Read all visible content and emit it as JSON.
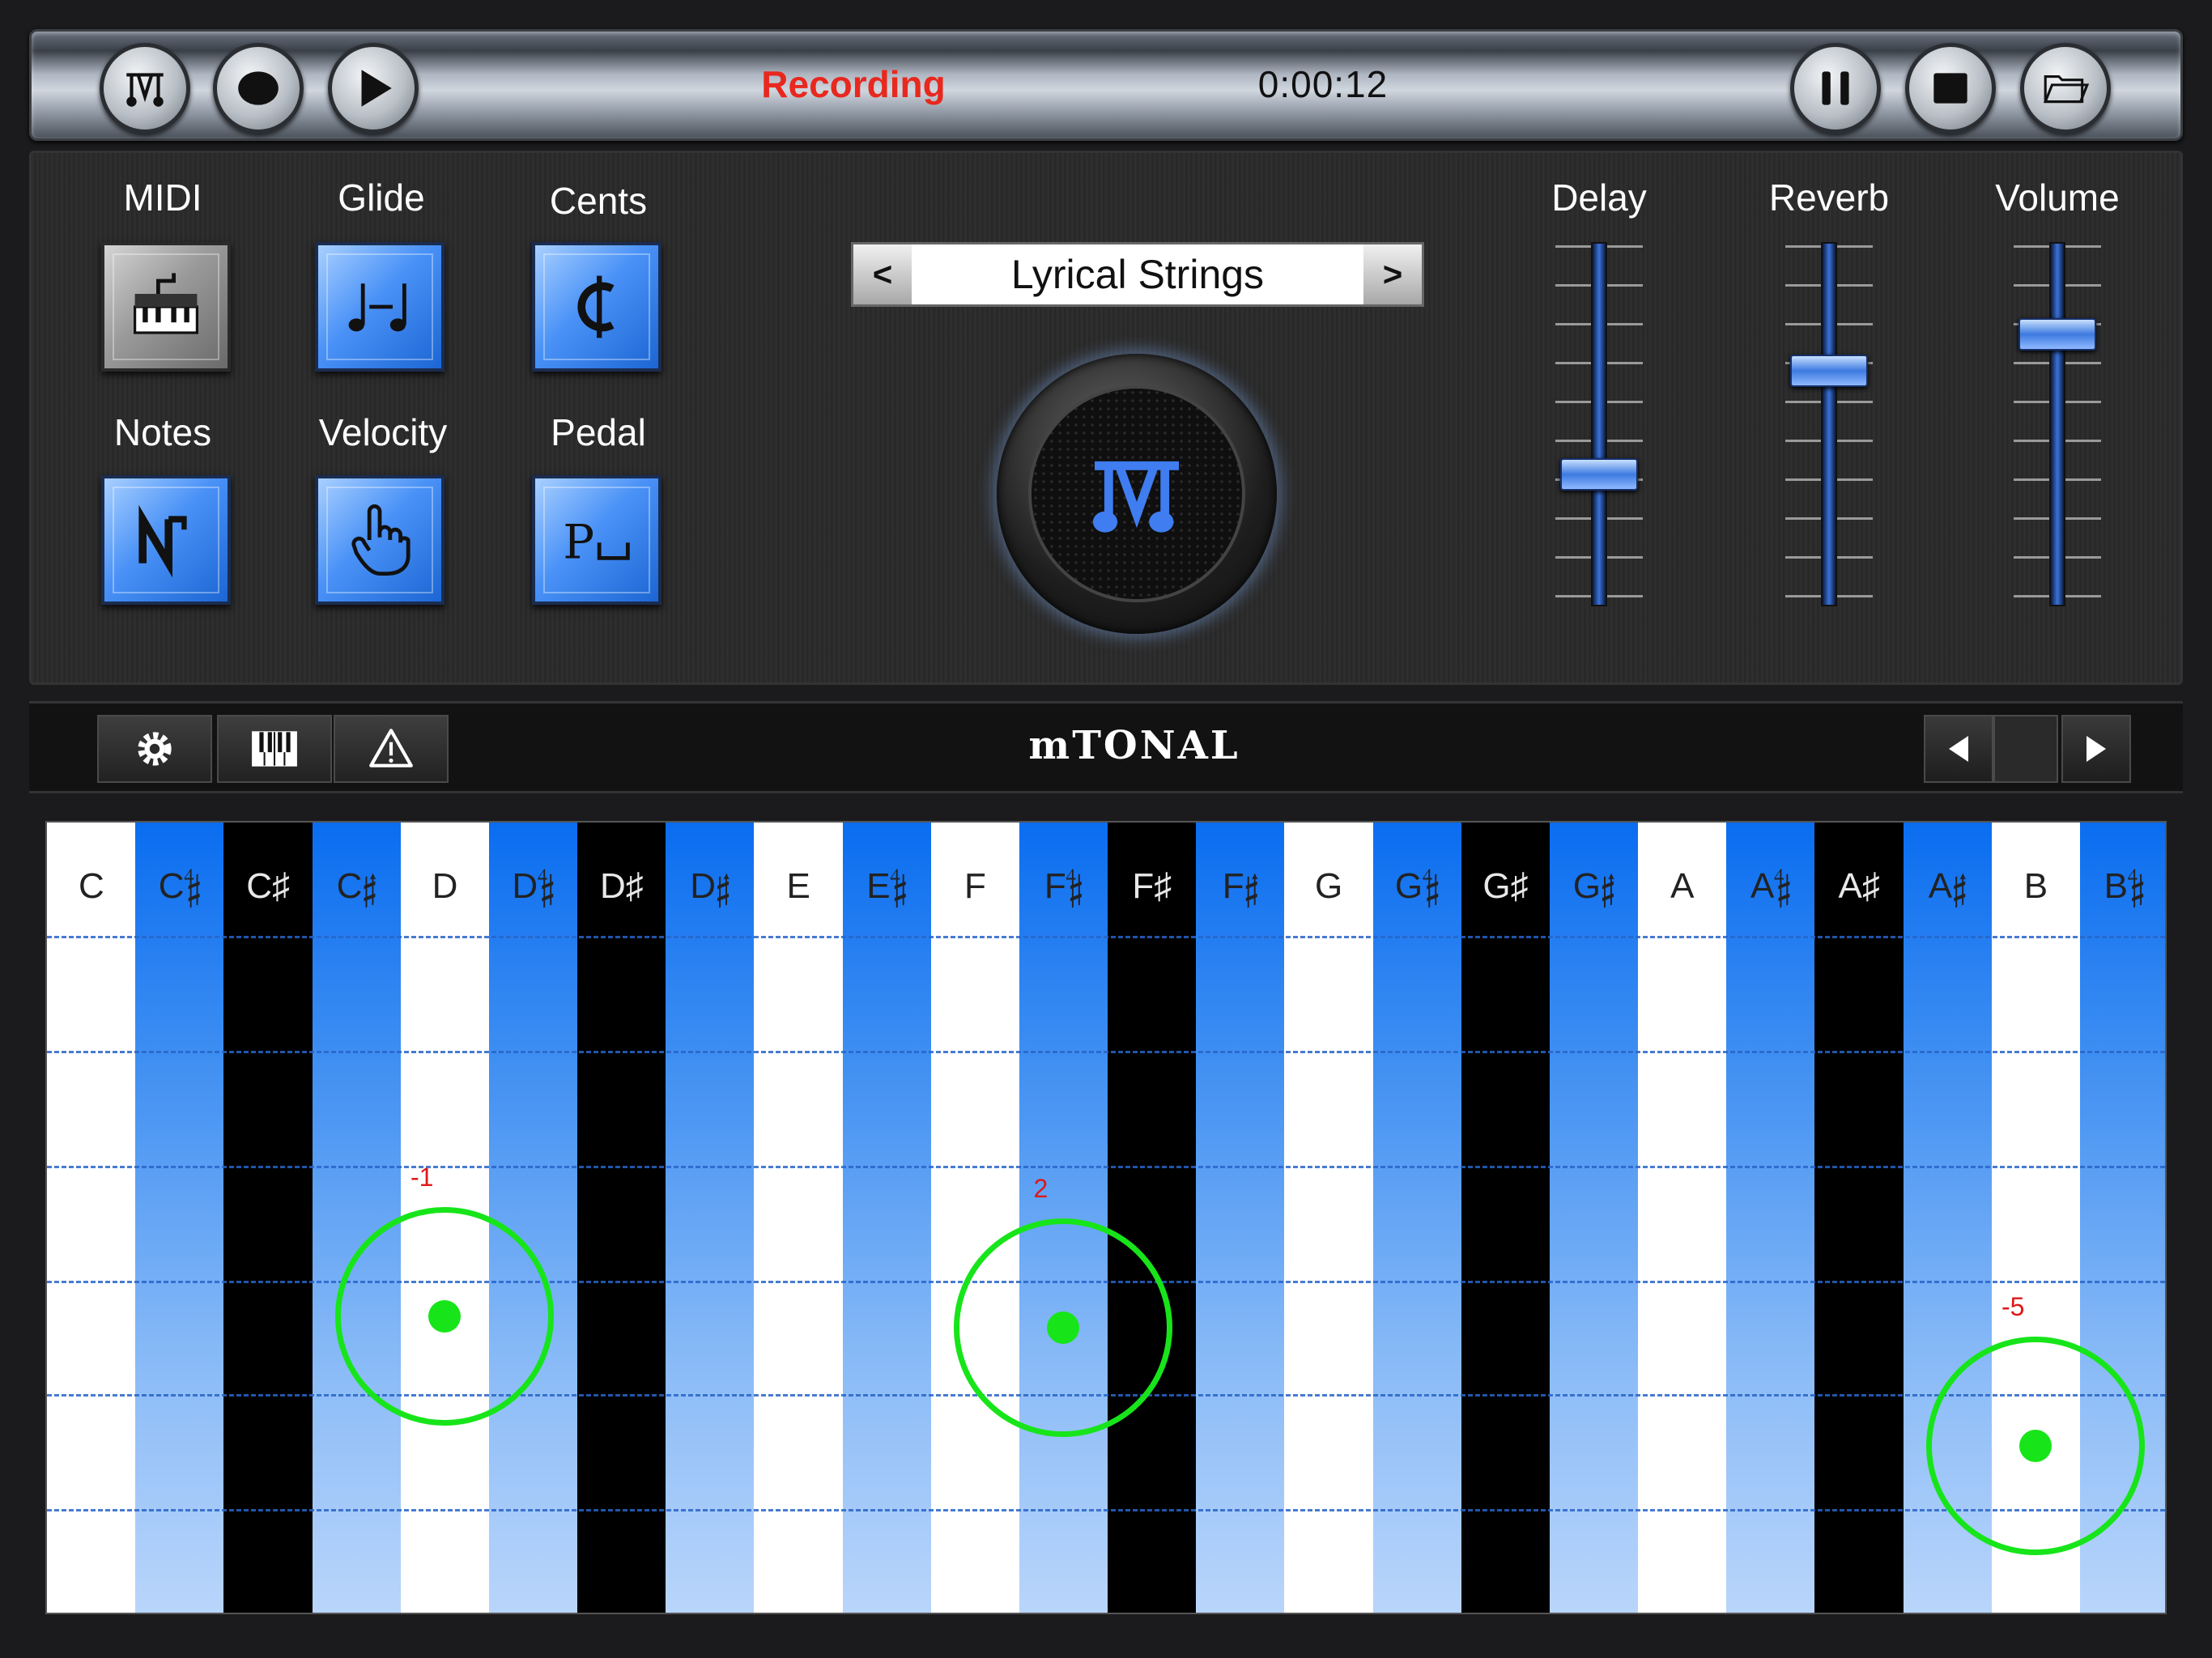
{
  "transport": {
    "status": "Recording",
    "time": "0:00:12",
    "status_color": "#e8281e",
    "buttons": [
      "logo-icon",
      "record-icon",
      "play-icon",
      "pause-icon",
      "stop-icon",
      "folder-icon"
    ]
  },
  "controls": {
    "midi_label": "MIDI",
    "glide_label": "Glide",
    "cents_label": "Cents",
    "notes_label": "Notes",
    "velocity_label": "Velocity",
    "pedal_label": "Pedal",
    "midi_active": false,
    "glide_active": true,
    "cents_active": true,
    "notes_active": true,
    "velocity_active": true,
    "pedal_active": true
  },
  "preset": {
    "prev": "<",
    "name": "Lyrical Strings",
    "next": ">"
  },
  "sliders": {
    "delay": {
      "label": "Delay",
      "value": 0.35
    },
    "reverb": {
      "label": "Reverb",
      "value": 0.66
    },
    "volume": {
      "label": "Volume",
      "value": 0.77
    }
  },
  "toolbar": {
    "title": "mTONAL",
    "icons": [
      "gear-icon",
      "keyboard-icon",
      "warning-icon",
      "prev-arrow-icon",
      "next-arrow-icon"
    ]
  },
  "keyboard": {
    "keys": [
      {
        "label": "C",
        "type": "white"
      },
      {
        "label": "C𝄲",
        "type": "blue"
      },
      {
        "label": "C♯",
        "type": "black"
      },
      {
        "label": "C𝄰",
        "type": "blue"
      },
      {
        "label": "D",
        "type": "white"
      },
      {
        "label": "D𝄲",
        "type": "blue"
      },
      {
        "label": "D♯",
        "type": "black"
      },
      {
        "label": "D𝄰",
        "type": "blue"
      },
      {
        "label": "E",
        "type": "white"
      },
      {
        "label": "E𝄲",
        "type": "blue"
      },
      {
        "label": "F",
        "type": "white"
      },
      {
        "label": "F𝄲",
        "type": "blue"
      },
      {
        "label": "F♯",
        "type": "black"
      },
      {
        "label": "F𝄰",
        "type": "blue"
      },
      {
        "label": "G",
        "type": "white"
      },
      {
        "label": "G𝄲",
        "type": "blue"
      },
      {
        "label": "G♯",
        "type": "black"
      },
      {
        "label": "G𝄰",
        "type": "blue"
      },
      {
        "label": "A",
        "type": "white"
      },
      {
        "label": "A𝄲",
        "type": "blue"
      },
      {
        "label": "A♯",
        "type": "black"
      },
      {
        "label": "A𝄰",
        "type": "blue"
      },
      {
        "label": "B",
        "type": "white"
      },
      {
        "label": "B𝄲",
        "type": "blue"
      }
    ],
    "touches": [
      {
        "key": 4,
        "label": "-1"
      },
      {
        "key": 11,
        "label": "2"
      },
      {
        "key": 22,
        "label": "-5"
      }
    ],
    "touch_color": "#17e51a",
    "gridline_color": "#2864c8"
  }
}
